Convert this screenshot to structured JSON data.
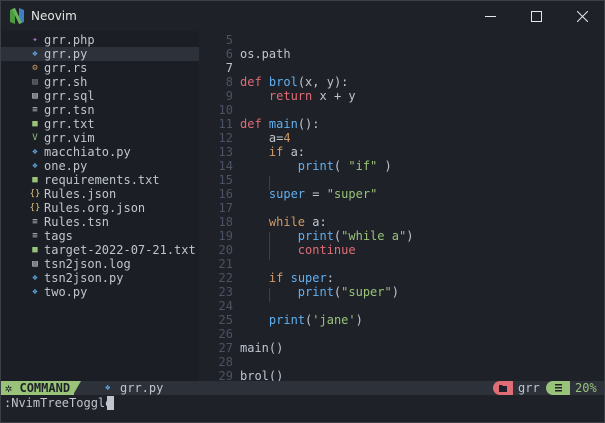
{
  "window": {
    "title": "Neovim",
    "logo_icon": "neovim-logo-icon"
  },
  "tree": {
    "selected_index": 1,
    "items": [
      {
        "label": "grr.php",
        "icon": "php-file-icon",
        "color": "#a074c4",
        "glyph": "✦"
      },
      {
        "label": "grr.py",
        "icon": "python-file-icon",
        "color": "#61afef",
        "glyph": "❖"
      },
      {
        "label": "grr.rs",
        "icon": "rust-file-icon",
        "color": "#d19a66",
        "glyph": "⚙"
      },
      {
        "label": "grr.sh",
        "icon": "shell-file-icon",
        "color": "#7f848e",
        "glyph": "▤"
      },
      {
        "label": "grr.sql",
        "icon": "database-file-icon",
        "color": "#dcdfe4",
        "glyph": "▤"
      },
      {
        "label": "grr.tsn",
        "icon": "text-file-icon",
        "color": "#c0c5ce",
        "glyph": "≡"
      },
      {
        "label": "grr.txt",
        "icon": "txt-file-icon",
        "color": "#98c379",
        "glyph": "■"
      },
      {
        "label": "grr.vim",
        "icon": "vim-file-icon",
        "color": "#98c379",
        "glyph": "V"
      },
      {
        "label": "macchiato.py",
        "icon": "python-file-icon",
        "color": "#61afef",
        "glyph": "❖"
      },
      {
        "label": "one.py",
        "icon": "python-file-icon",
        "color": "#61afef",
        "glyph": "❖"
      },
      {
        "label": "requirements.txt",
        "icon": "txt-file-icon",
        "color": "#98c379",
        "glyph": "■"
      },
      {
        "label": "Rules.json",
        "icon": "json-file-icon",
        "color": "#e5c07b",
        "glyph": "{}"
      },
      {
        "label": "Rules.org.json",
        "icon": "json-file-icon",
        "color": "#e5c07b",
        "glyph": "{}"
      },
      {
        "label": "Rules.tsn",
        "icon": "text-file-icon",
        "color": "#c0c5ce",
        "glyph": "≡"
      },
      {
        "label": "tags",
        "icon": "text-file-icon",
        "color": "#c0c5ce",
        "glyph": "≡"
      },
      {
        "label": "target-2022-07-21.txt",
        "icon": "txt-file-icon",
        "color": "#98c379",
        "glyph": "■"
      },
      {
        "label": "tsn2json.log",
        "icon": "log-file-icon",
        "color": "#dcdfe4",
        "glyph": "▤"
      },
      {
        "label": "tsn2json.py",
        "icon": "python-file-icon",
        "color": "#61afef",
        "glyph": "❖"
      },
      {
        "label": "two.py",
        "icon": "python-file-icon",
        "color": "#61afef",
        "glyph": "❖"
      }
    ]
  },
  "editor": {
    "current_line": "7",
    "lines": [
      {
        "n": "5",
        "tokens": []
      },
      {
        "n": "6",
        "tokens": [
          {
            "t": "os.path",
            "c": "plain"
          }
        ]
      },
      {
        "n": "7",
        "tokens": []
      },
      {
        "n": "8",
        "tokens": [
          {
            "t": "def",
            "c": "kw"
          },
          {
            "t": " ",
            "c": "plain"
          },
          {
            "t": "brol",
            "c": "fn"
          },
          {
            "t": "(x, y):",
            "c": "plain"
          }
        ]
      },
      {
        "n": "9",
        "tokens": [
          {
            "t": "    ",
            "c": "plain"
          },
          {
            "t": "return",
            "c": "kw"
          },
          {
            "t": " x + y",
            "c": "plain"
          }
        ]
      },
      {
        "n": "10",
        "tokens": []
      },
      {
        "n": "11",
        "tokens": [
          {
            "t": "def",
            "c": "kw"
          },
          {
            "t": " ",
            "c": "plain"
          },
          {
            "t": "main",
            "c": "fn"
          },
          {
            "t": "():",
            "c": "plain"
          }
        ]
      },
      {
        "n": "12",
        "tokens": [
          {
            "t": "    a=",
            "c": "plain"
          },
          {
            "t": "4",
            "c": "num"
          }
        ]
      },
      {
        "n": "13",
        "tokens": [
          {
            "t": "    ",
            "c": "plain"
          },
          {
            "t": "if",
            "c": "ctl"
          },
          {
            "t": " a:",
            "c": "plain"
          }
        ]
      },
      {
        "n": "14",
        "tokens": [
          {
            "t": "        ",
            "c": "plain"
          },
          {
            "t": "print",
            "c": "builtin"
          },
          {
            "t": "( ",
            "c": "plain"
          },
          {
            "t": "\"if\"",
            "c": "str"
          },
          {
            "t": " )",
            "c": "plain"
          }
        ]
      },
      {
        "n": "15",
        "tokens": []
      },
      {
        "n": "16",
        "tokens": [
          {
            "t": "    ",
            "c": "plain"
          },
          {
            "t": "super",
            "c": "builtin"
          },
          {
            "t": " = ",
            "c": "plain"
          },
          {
            "t": "\"super\"",
            "c": "str"
          }
        ]
      },
      {
        "n": "17",
        "tokens": []
      },
      {
        "n": "18",
        "tokens": [
          {
            "t": "    ",
            "c": "plain"
          },
          {
            "t": "while",
            "c": "ctl"
          },
          {
            "t": " a:",
            "c": "plain"
          }
        ]
      },
      {
        "n": "19",
        "tokens": [
          {
            "t": "        ",
            "c": "plain"
          },
          {
            "t": "print",
            "c": "builtin"
          },
          {
            "t": "(",
            "c": "plain"
          },
          {
            "t": "\"while a\"",
            "c": "str"
          },
          {
            "t": ")",
            "c": "plain"
          }
        ]
      },
      {
        "n": "20",
        "tokens": [
          {
            "t": "        ",
            "c": "plain"
          },
          {
            "t": "continue",
            "c": "cont"
          }
        ]
      },
      {
        "n": "21",
        "tokens": []
      },
      {
        "n": "22",
        "tokens": [
          {
            "t": "    ",
            "c": "plain"
          },
          {
            "t": "if",
            "c": "ctl"
          },
          {
            "t": " ",
            "c": "plain"
          },
          {
            "t": "super",
            "c": "builtin"
          },
          {
            "t": ":",
            "c": "plain"
          }
        ]
      },
      {
        "n": "23",
        "tokens": [
          {
            "t": "        ",
            "c": "plain"
          },
          {
            "t": "print",
            "c": "builtin"
          },
          {
            "t": "(",
            "c": "plain"
          },
          {
            "t": "\"super\"",
            "c": "str"
          },
          {
            "t": ")",
            "c": "plain"
          }
        ]
      },
      {
        "n": "24",
        "tokens": []
      },
      {
        "n": "25",
        "tokens": [
          {
            "t": "    ",
            "c": "plain"
          },
          {
            "t": "print",
            "c": "builtin"
          },
          {
            "t": "(",
            "c": "plain"
          },
          {
            "t": "'jane'",
            "c": "str"
          },
          {
            "t": ")",
            "c": "plain"
          }
        ]
      },
      {
        "n": "26",
        "tokens": []
      },
      {
        "n": "27",
        "tokens": [
          {
            "t": "main()",
            "c": "plain"
          }
        ]
      },
      {
        "n": "28",
        "tokens": []
      },
      {
        "n": "29",
        "tokens": [
          {
            "t": "brol()",
            "c": "plain"
          }
        ]
      }
    ]
  },
  "statusline": {
    "mode": "COMMAND",
    "mode_icon": "gear-icon",
    "file_icon": "python-file-icon",
    "filename": "grr.py",
    "folder_icon": "folder-icon",
    "branch": "grr",
    "lines_icon": "lines-icon",
    "percent": "20%",
    "colors": {
      "mode_bg": "#98c379",
      "folder_bg": "#e06c75"
    }
  },
  "cmdline": {
    "text": ":NvimTreeToggle"
  }
}
